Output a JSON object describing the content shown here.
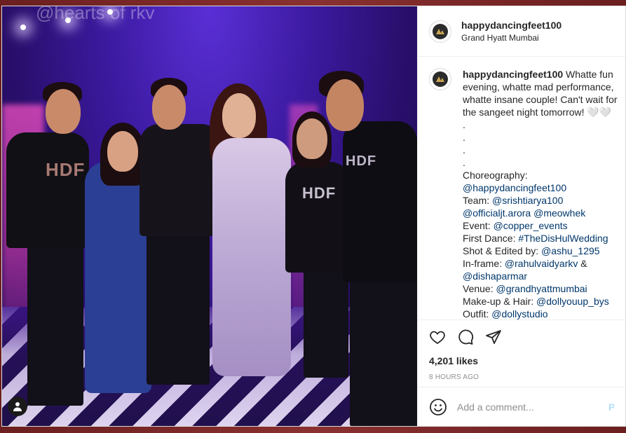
{
  "photo": {
    "watermark": "@hearts of rkv",
    "shirt_logo_1": "HDF",
    "shirt_logo_2": "HDF",
    "shirt_logo_3": "HDF"
  },
  "header": {
    "username": "happydancingfeet100",
    "location": "Grand Hyatt Mumbai"
  },
  "caption": {
    "username": "happydancingfeet100",
    "intro": " Whatte fun evening, whatte mad performance, whatte insane couple! Can't wait for the sangeet night tomorrow! 🤍🤍",
    "dots": "\n.\n.\n.\n.",
    "lines": [
      {
        "label": "Choreography:",
        "value": "@happydancingfeet100",
        "break": true
      },
      {
        "label": "Team: ",
        "value": "@srishtiarya100"
      },
      {
        "label": "",
        "value": "@officialjt.arora @meowhek"
      },
      {
        "label": "Event: ",
        "value": "@copper_events"
      },
      {
        "label": "First Dance: ",
        "value": "#TheDisHulWedding"
      },
      {
        "label": "Shot & Edited by: ",
        "value": "@ashu_1295"
      },
      {
        "label": "In-frame: ",
        "value": "@rahulvaidyarkv",
        "suffix": " &"
      },
      {
        "label": "",
        "value": "@dishaparmar"
      },
      {
        "label": "Venue: ",
        "value": "@grandhyattmumbai"
      },
      {
        "label": "Make-up & Hair: ",
        "value": "@dollyouup_bys"
      },
      {
        "label": "Outfit: ",
        "value": "@dollystudio"
      }
    ]
  },
  "actions": {
    "likes": "4,201 likes",
    "time": "8 HOURS AGO"
  },
  "comment_box": {
    "placeholder": "Add a comment...",
    "post_label": "Post"
  },
  "colors": {
    "mention": "#00376b",
    "text": "#262626",
    "muted": "#8e8e8e"
  }
}
